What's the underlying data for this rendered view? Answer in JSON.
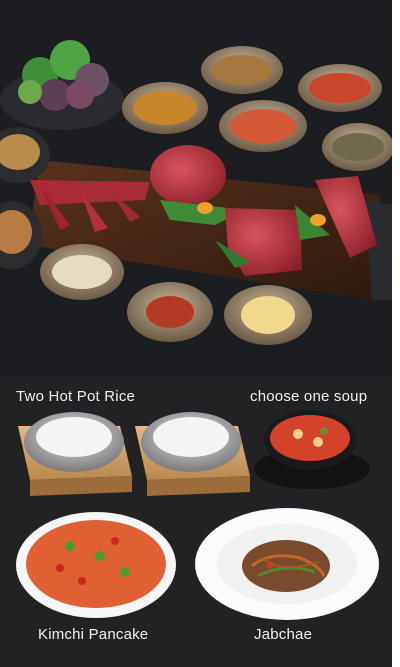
{
  "captions": {
    "rice": "Two Hot Pot Rice",
    "soup": "choose one soup",
    "pancake": "Kimchi Pancake",
    "jabchae": "Jabchae"
  },
  "colors": {
    "hero_bg": "#1b1c1f",
    "panel_bg": "#222225",
    "caption_text": "#f1f1f1",
    "board_wood": "#4a2a1a",
    "beef_red": "#b2323c",
    "kimchi_red": "#d9452a"
  }
}
